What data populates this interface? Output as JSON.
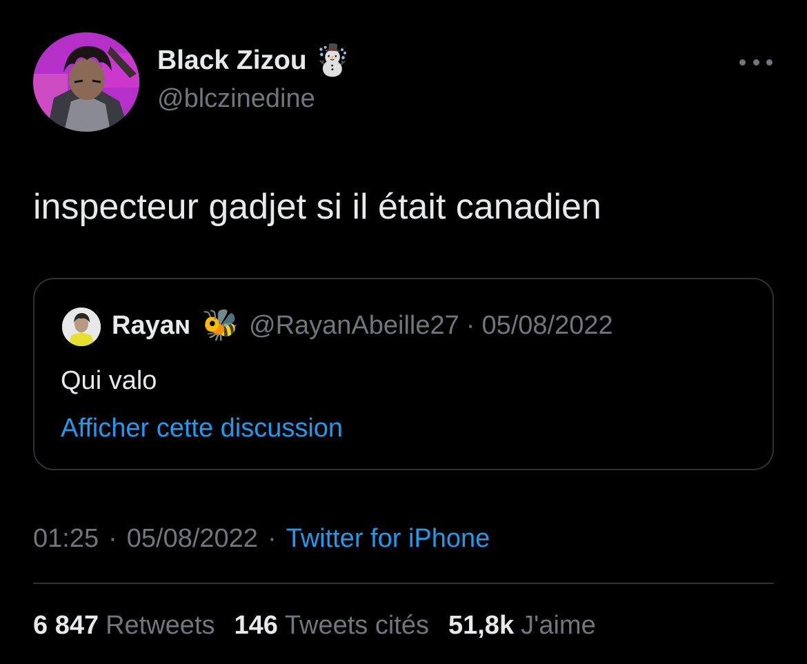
{
  "author": {
    "display_name": "Black Zizou",
    "name_emoji": "☃️",
    "handle": "@blczinedine"
  },
  "tweet": {
    "text": "inspecteur gadjet si il était canadien"
  },
  "quoted_tweet": {
    "display_name": "Rayaɴ",
    "name_emoji": "🐝",
    "handle": "@RayanAbeille27",
    "separator": "·",
    "date": "05/08/2022",
    "text": "Qui valo",
    "show_thread_label": "Afficher cette discussion"
  },
  "meta": {
    "time": "01:25",
    "separator": "·",
    "date": "05/08/2022",
    "source": "Twitter for iPhone"
  },
  "stats": {
    "retweets_count": "6 847",
    "retweets_label": "Retweets",
    "quotes_count": "146",
    "quotes_label": "Tweets cités",
    "likes_count": "51,8k",
    "likes_label": "J'aime"
  },
  "colors": {
    "background": "#000000",
    "primary_text": "#e7e9ea",
    "secondary_text": "#71767b",
    "link": "#1d9bf0",
    "border": "#2f3336"
  },
  "icons": {
    "more": "more-horizontal-icon"
  }
}
